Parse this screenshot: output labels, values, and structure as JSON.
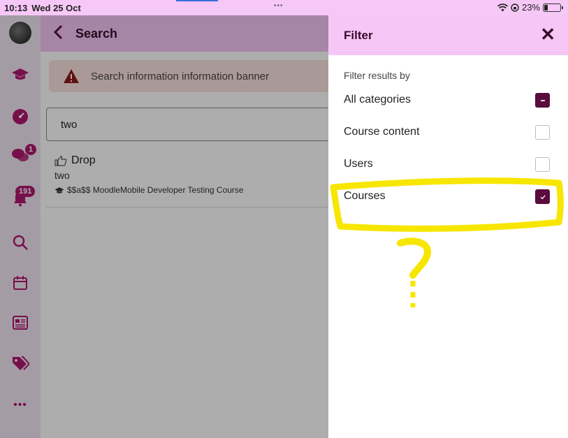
{
  "status_bar": {
    "time": "10:13",
    "date": "Wed 25 Oct",
    "battery": "23%",
    "battery_level": 0.23,
    "dots": "•••"
  },
  "side_menu": {
    "items": [
      {
        "icon": "avatar"
      },
      {
        "icon": "graduation-cap-icon"
      },
      {
        "icon": "dashboard-icon"
      },
      {
        "icon": "messages-icon",
        "badge": "1"
      },
      {
        "icon": "notifications-bell-icon",
        "badge": "191"
      },
      {
        "icon": "search-icon"
      },
      {
        "icon": "calendar-icon"
      },
      {
        "icon": "news-icon"
      },
      {
        "icon": "tags-icon"
      },
      {
        "icon": "more-icon",
        "label": "•••"
      }
    ]
  },
  "page": {
    "title": "Search",
    "banner": "Search information information banner",
    "search_value": "two",
    "results": [
      {
        "title": "Drop",
        "subtitle": "two",
        "course": "$$a$$ MoodleMobile Developer Testing Course"
      }
    ]
  },
  "filter": {
    "title": "Filter",
    "close_label": "✕",
    "subtitle": "Filter results by",
    "options": [
      {
        "label": "All categories",
        "state": "indeterminate"
      },
      {
        "label": "Course content",
        "state": "unchecked"
      },
      {
        "label": "Users",
        "state": "unchecked"
      },
      {
        "label": "Courses",
        "state": "checked"
      }
    ]
  },
  "annotation": {
    "mark": "?",
    "color": "#f7e600"
  },
  "colors": {
    "accent": "#5a0c3c",
    "header": "#f5c6f6",
    "badge": "#b0176f"
  }
}
